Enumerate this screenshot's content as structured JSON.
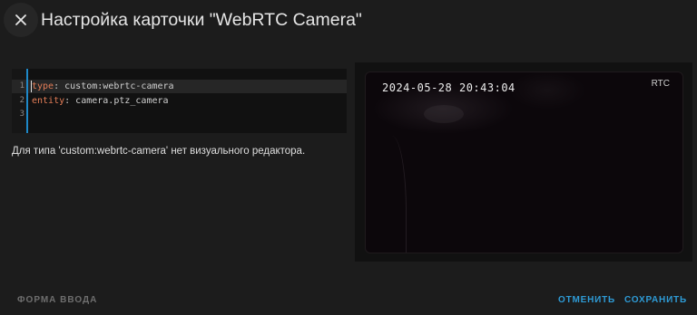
{
  "dialog": {
    "title": "Настройка карточки \"WebRTC Camera\"",
    "close_icon": "close-icon"
  },
  "editor": {
    "lines": [
      {
        "number": "1",
        "key": "type",
        "sep": ": ",
        "value": "custom:webrtc-camera"
      },
      {
        "number": "2",
        "key": "entity",
        "sep": ": ",
        "value": "camera.ptz_camera"
      },
      {
        "number": "3",
        "key": "",
        "sep": "",
        "value": ""
      }
    ],
    "accent_color": "#1e88c8"
  },
  "notice": "Для типа 'custom:webrtc-camera' нет визуального редактора.",
  "preview": {
    "timestamp": "2024-05-28 20:43:04",
    "mode_badge": "RTC"
  },
  "footer": {
    "form_label": "ФОРМА ВВОДА",
    "cancel_label": "ОТМЕНИТЬ",
    "save_label": "СОХРАНИТЬ",
    "action_color": "#2e9bd6"
  }
}
